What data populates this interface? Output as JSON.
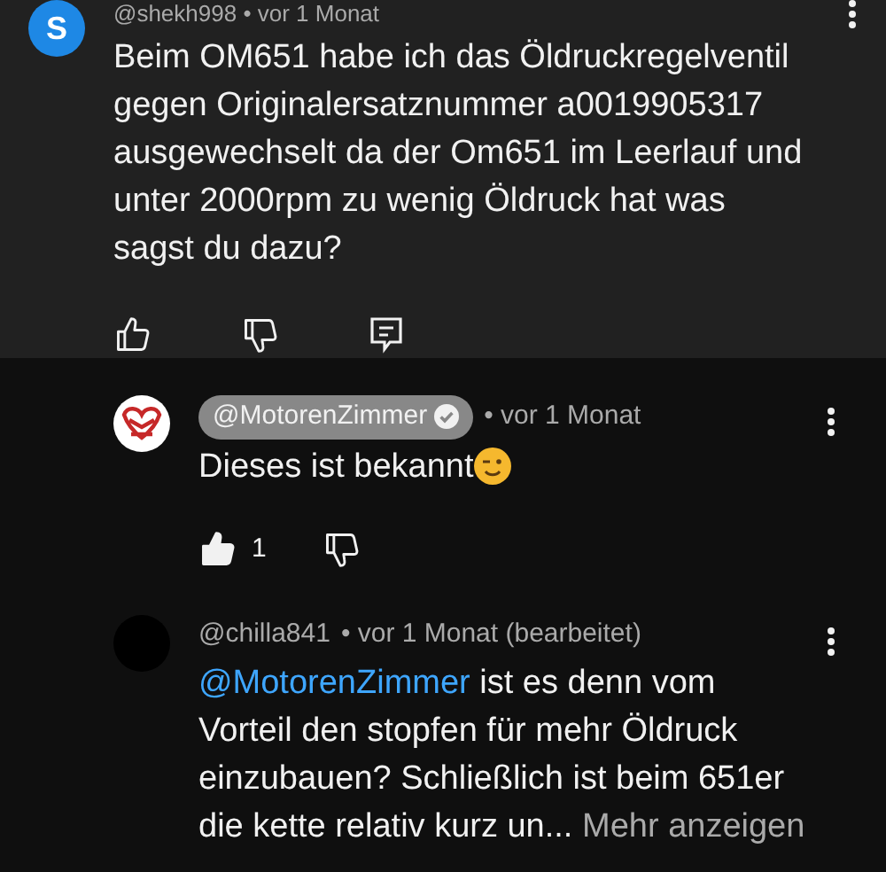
{
  "comment": {
    "author": "@shekh998",
    "time": "• vor 1 Monat",
    "lines": [
      "Beim OM651 habe ich das Öldruckregelventil",
      "gegen Originalersatznummer a0019905317",
      "ausgewechselt da der Om651 im Leerlauf und",
      "unter 2000rpm zu wenig Öldruck hat was",
      "sagst du dazu?"
    ],
    "avatar_letter": "S"
  },
  "replies": [
    {
      "kind": "creator",
      "author": "@MotorenZimmer",
      "verified": true,
      "time": "• vor 1 Monat",
      "lines": [
        "Dieses ist bekannt"
      ],
      "likes": "1",
      "liked": true
    },
    {
      "kind": "user",
      "author": "@chilla841",
      "time": "• vor 1 Monat (bearbeitet)",
      "mention": "@MotorenZimmer",
      "lines": [
        " ist es denn vom",
        "Vorteil den stopfen für mehr Öldruck",
        "einzubauen? Schließlich ist beim 651er",
        "die kette relativ kurz un..."
      ],
      "more": "Mehr anzeigen"
    }
  ]
}
